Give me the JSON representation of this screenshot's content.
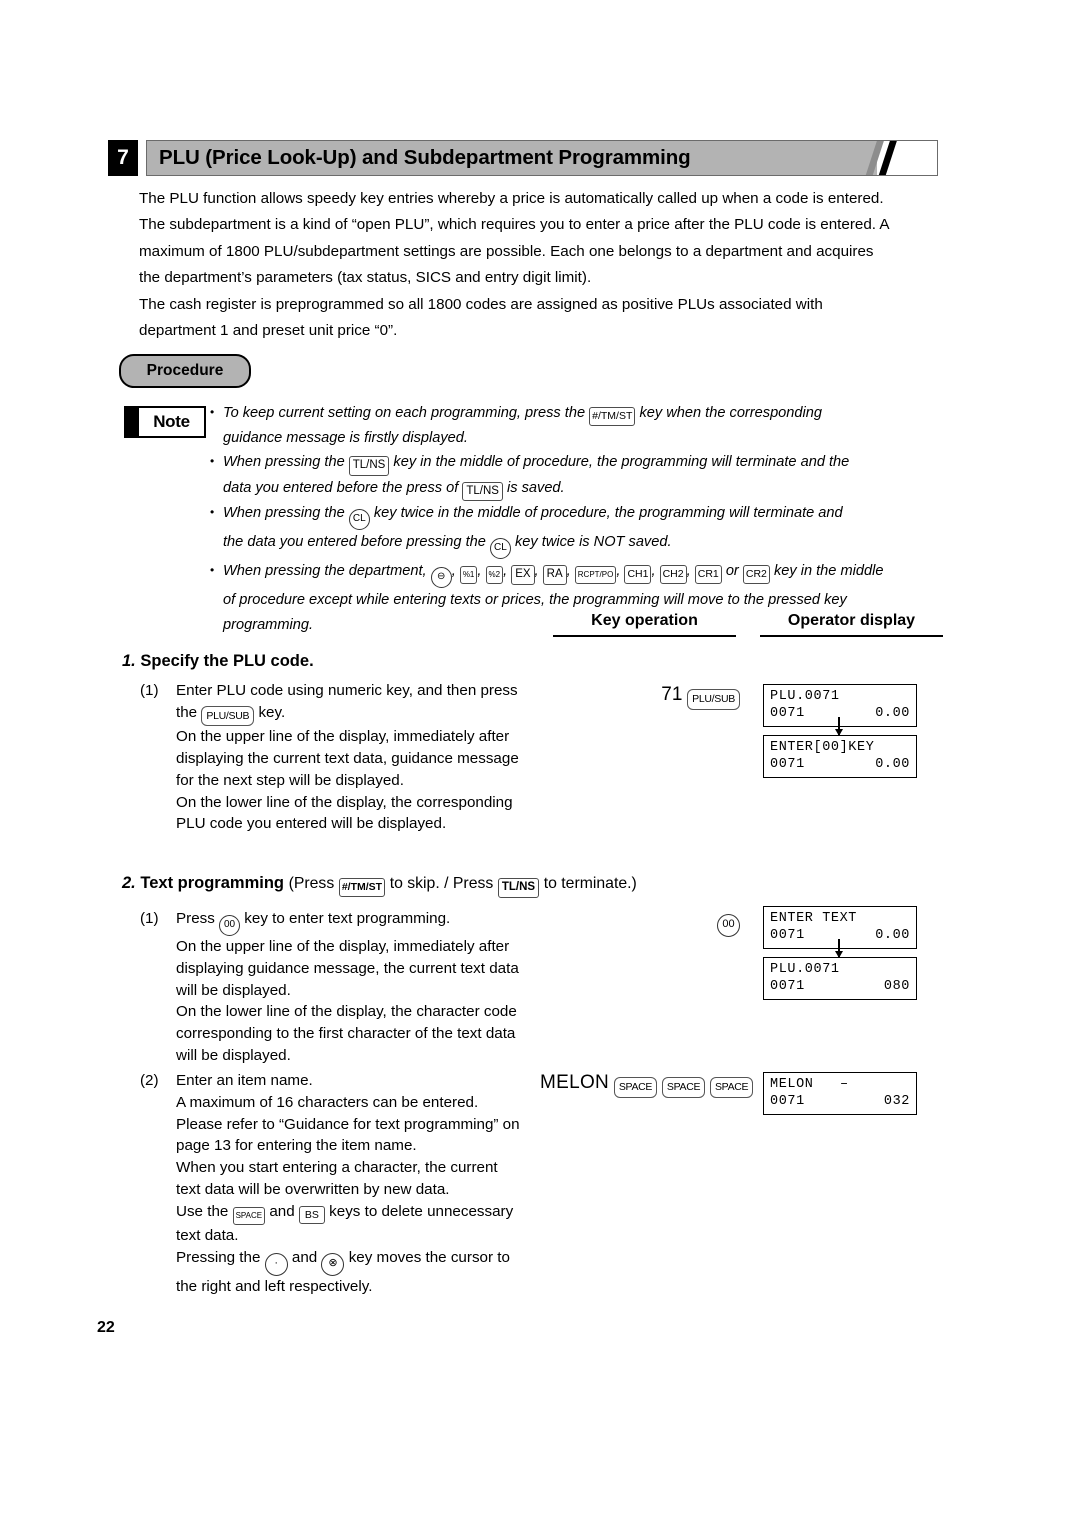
{
  "section": {
    "number": "7",
    "title": "PLU (Price Look-Up) and Subdepartment Programming"
  },
  "intro": {
    "line1": "The PLU function allows speedy key entries whereby a price is automatically called up when a code is entered.",
    "line2": "The subdepartment is a kind of “open PLU”, which requires you to enter a price after the PLU code is entered.  A",
    "line3": "maximum of 1800 PLU/subdepartment settings are possible. Each one belongs to a department and acquires",
    "line4": "the department’s parameters (tax status, SICS and entry digit limit).",
    "line5": "The cash register is preprogrammed so all 1800 codes are assigned as positive PLUs associated with",
    "line6": "department 1 and preset unit price “0”."
  },
  "procedure": {
    "label": "Procedure"
  },
  "note": {
    "label": "Note",
    "item1_a": "To keep current setting on each programming, press the",
    "item1_key": "#/TM/ST",
    "item1_b": "key when the corresponding",
    "item1_c": "guidance message is firstly displayed.",
    "item2_a": "When pressing the",
    "item2_key1": "TL/NS",
    "item2_b": "key in the middle of procedure, the programming will terminate and the",
    "item2_c": "data you entered before the press of",
    "item2_key2": "TL/NS",
    "item2_d": "is saved.",
    "item3_a": "When pressing the",
    "item3_key1": "CL",
    "item3_b": "key twice in the middle of procedure, the programming will terminate and",
    "item3_c": "the data you entered before pressing the",
    "item3_key2": "CL",
    "item3_d": "key twice is NOT saved.",
    "item4_a": "When pressing the department,",
    "item4_keys": [
      "⊖",
      "%1",
      "%2",
      "EX",
      "RA",
      "RCPT/PO",
      "CH1",
      "CH2",
      "CR1",
      "CR2"
    ],
    "item4_or": "or",
    "item4_b": "key in the middle",
    "item4_c": "of procedure except while entering texts or prices, the programming will move to the pressed key",
    "item4_d": "programming."
  },
  "columns": {
    "key_operation": "Key operation",
    "operator_display": "Operator display"
  },
  "step1": {
    "number": "1.",
    "title": "Specify the PLU code.",
    "marker": "(1)",
    "l1": "Enter PLU code using numeric key, and then press",
    "l2_a": "the",
    "l2_key": "PLU/SUB",
    "l2_b": "key.",
    "l3": "On the upper line of the display, immediately after",
    "l4": "displaying the current text data, guidance message",
    "l5": "for the next step will be displayed.",
    "l6": "On the lower line of the display, the corresponding",
    "l7": "PLU code you entered will be displayed.",
    "keyop_num": "71",
    "keyop_key": "PLU/SUB",
    "display1_top": "PLU.0071",
    "display1_left": "0071",
    "display1_right": "0.00",
    "display2_top": "ENTER[00]KEY",
    "display2_left": "0071",
    "display2_right": "0.00"
  },
  "step2": {
    "number": "2.",
    "title": "Text programming",
    "title_paren_a": "(Press",
    "title_key1": "#/TM/ST",
    "title_paren_b": "to skip. / Press",
    "title_key2": "TL/NS",
    "title_paren_c": "to terminate.)",
    "sub1_marker": "(1)",
    "sub1_l1_a": "Press",
    "sub1_l1_key": "00",
    "sub1_l1_b": "key to enter text programming.",
    "sub1_l2": "On the upper line of the display, immediately after",
    "sub1_l3": "displaying guidance message, the current text data",
    "sub1_l4": "will be displayed.",
    "sub1_l5": "On the lower line of the display, the character code",
    "sub1_l6": "corresponding to the first character of the text data",
    "sub1_l7": "will be displayed.",
    "sub2_marker": "(2)",
    "sub2_l1": "Enter an item name.",
    "sub2_l2": "A maximum of 16 characters can be entered.",
    "sub2_l3": "Please refer to “Guidance for text programming” on",
    "sub2_l4": "page 13 for entering the item name.",
    "sub2_l5": "When you start entering a character, the current",
    "sub2_l6": "text data will be overwritten by new data.",
    "sub2_l7_a": "Use the",
    "sub2_l7_key1": "SPACE",
    "sub2_l7_b": "and",
    "sub2_l7_key2": "BS",
    "sub2_l7_c": "keys to delete unnecessary",
    "sub2_l8": "text data.",
    "sub2_l9_a": "Pressing the",
    "sub2_l9_key1": "·",
    "sub2_l9_b": "and",
    "sub2_l9_key2": "⊗",
    "sub2_l9_c": "key moves the cursor to",
    "sub2_l10": "the right and left respectively.",
    "keyop2_key": "00",
    "keyop3_text": "MELON",
    "keyop3_key": "SPACE",
    "display3_top": "ENTER TEXT",
    "display3_left": "0071",
    "display3_right": "0.00",
    "display4_top": "PLU.0071",
    "display4_left": "0071",
    "display4_right": "080",
    "display5_top_left": "MELON",
    "display5_top_right": "–",
    "display5_left": "0071",
    "display5_right": "032"
  },
  "page_number": "22"
}
